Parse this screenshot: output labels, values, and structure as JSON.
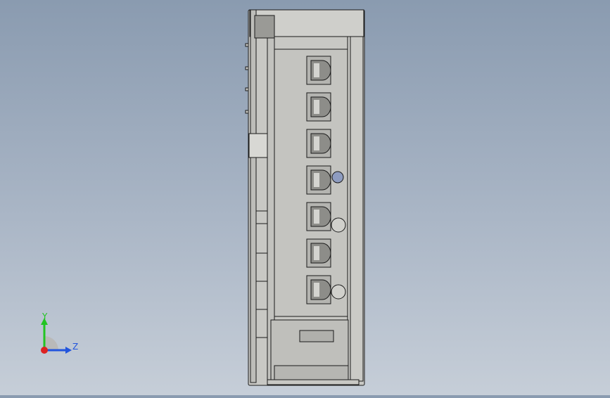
{
  "viewport": {
    "background_top": "#8a9bb0",
    "background_bottom": "#c6ced8",
    "model_body_color": "#c8c8c4",
    "model_edge_color": "#1a1a1a",
    "model_shadow_color": "#a5a5a0"
  },
  "model": {
    "name": "connector-side-view",
    "terminal_count": 7
  },
  "triad": {
    "y_label": "Y",
    "z_label": "Z",
    "y_color": "#22c422",
    "z_color": "#2255dd",
    "x_color": "#dd2222"
  }
}
